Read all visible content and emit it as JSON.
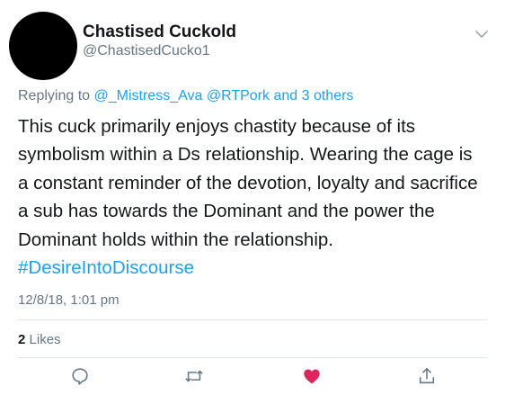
{
  "tweet": {
    "display_name": "Chastised Cuckold",
    "handle": "@ChastisedCucko1",
    "reply_prefix": "Replying to",
    "reply_mentions": "@_Mistress_Ava @RTPork",
    "reply_and": "and",
    "reply_others": "3 others",
    "lines": [
      "This cuck primarily enjoys chastity because of its",
      "symbolism within a Ds relationship.   Wearing the cage is",
      "a constant reminder of the devotion, loyalty and sacrifice",
      "a sub has towards the Dominant and the power the",
      "Dominant holds within the relationship."
    ],
    "hashtag": "#DesireIntoDiscourse",
    "timestamp": "12/8/18, 1:01 pm",
    "likes_count": "2",
    "likes_label": "Likes"
  },
  "colors": {
    "link": "#1da1f2",
    "secondary_text": "#657786",
    "like_active": "#e0245e",
    "divider": "#e1e8ed"
  },
  "icons": {
    "menu": "chevron-down-icon",
    "reply": "reply-icon",
    "retweet": "retweet-icon",
    "like": "heart-icon",
    "share": "share-icon"
  }
}
